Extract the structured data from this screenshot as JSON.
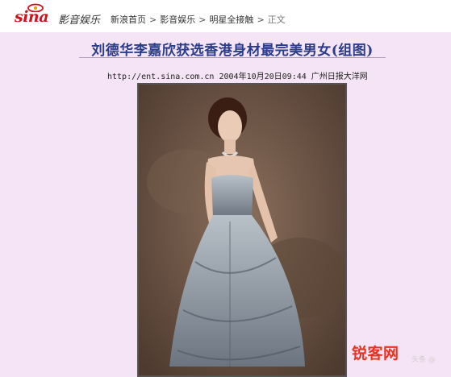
{
  "header": {
    "logo_text": "sina",
    "channel": "影音娱乐",
    "breadcrumb": [
      {
        "label": "新浪首页"
      },
      {
        "label": "影音娱乐"
      },
      {
        "label": "明星全接触"
      },
      {
        "label": "正文"
      }
    ],
    "breadcrumb_sep": ">"
  },
  "article": {
    "title": "刘德华李嘉欣获选香港身材最完美男女(组图)",
    "url": "http://ent.sina.com.cn",
    "datetime": "2004年10月20日09:44",
    "source": "广州日报大洋网"
  },
  "watermark": {
    "text": "锐客网",
    "sub": "头条 @"
  },
  "colors": {
    "band": "#f4e4f5",
    "title": "#2a3c8a",
    "logo": "#d0101a",
    "watermark": "#e8331f"
  }
}
